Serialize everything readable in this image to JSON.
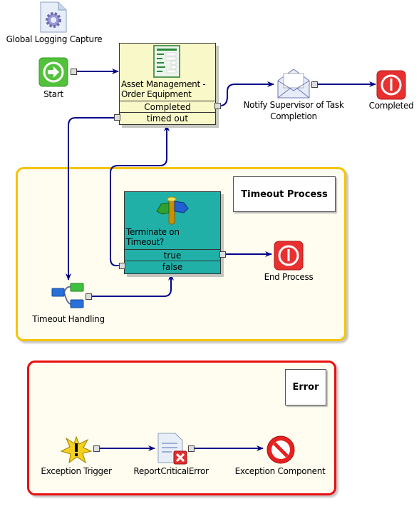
{
  "nodes": {
    "global_logging": {
      "label": "Global Logging Capture",
      "icon": "gear-document-icon"
    },
    "start": {
      "label": "Start",
      "icon": "start-arrow-icon"
    },
    "asset_task": {
      "title_line1": "Asset Management -",
      "title_line2": "Order Equipment",
      "outputs": [
        "Completed",
        "timed out"
      ],
      "icon": "form-icon"
    },
    "notify": {
      "label_line1": "Notify Supervisor of Task",
      "label_line2": "Completion",
      "icon": "envelope-icon"
    },
    "completed": {
      "label": "Completed",
      "icon": "stop-icon"
    },
    "terminate_decision": {
      "title_line1": "Terminate on",
      "title_line2": "Timeout?",
      "outputs": [
        "true",
        "false"
      ],
      "icon": "signpost-icon"
    },
    "end_process": {
      "label": "End Process",
      "icon": "stop-icon"
    },
    "timeout_handling": {
      "label": "Timeout Handling",
      "icon": "subprocess-icon"
    },
    "exception_trigger": {
      "label": "Exception Trigger",
      "icon": "exception-burst-icon"
    },
    "report_error": {
      "label": "ReportCriticalError",
      "icon": "document-error-icon"
    },
    "exception_component": {
      "label": "Exception Component",
      "icon": "no-entry-icon"
    }
  },
  "groups": {
    "timeout": {
      "label": "Timeout Process",
      "border_color": "#f5c400",
      "fill": "#fefdef"
    },
    "error": {
      "label": "Error",
      "border_color": "#e81010",
      "fill": "#fefdef"
    }
  },
  "colors": {
    "wire": "#00008b",
    "task_fill": "#f8f8c8",
    "decision_fill": "#20b0a8"
  }
}
